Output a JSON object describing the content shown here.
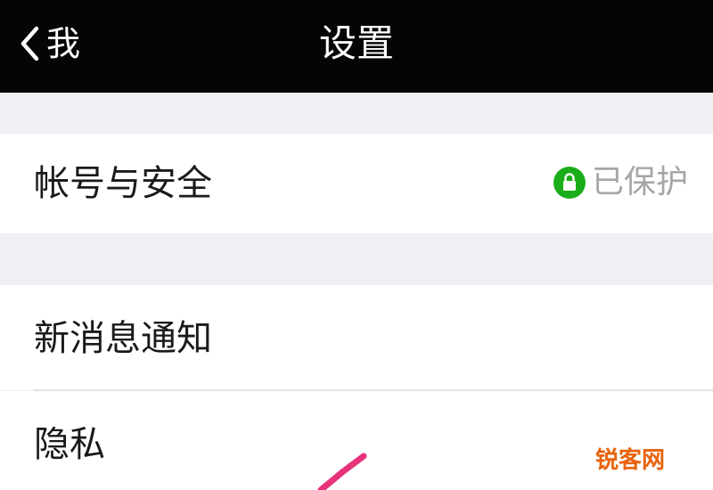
{
  "nav": {
    "back_label": "我",
    "title": "设置",
    "back_icon": "chevron-left-icon"
  },
  "sections": [
    {
      "rows": [
        {
          "label": "帐号与安全",
          "status_text": "已保护",
          "status_icon": "lock-icon",
          "status_color": "#1aad19"
        }
      ]
    },
    {
      "rows": [
        {
          "label": "新消息通知"
        },
        {
          "label": "隐私"
        }
      ]
    }
  ],
  "watermark": "锐客网",
  "colors": {
    "nav_background": "#050505",
    "page_background": "#efeff4",
    "cell_background": "#ffffff",
    "status_green": "#1aad19",
    "annotation_pink": "#e6337a"
  }
}
